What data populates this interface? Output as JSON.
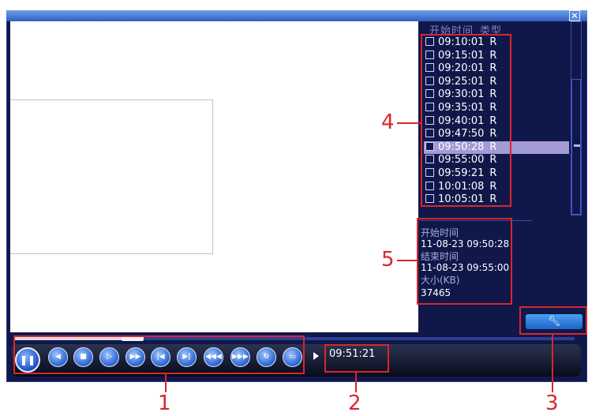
{
  "window": {
    "close_icon": "close-icon",
    "colors": {
      "panel_bg": "#10184a",
      "selected_row": "#a39ad6",
      "callout": "#d9262a",
      "title_bar": "#4f82d8"
    }
  },
  "record_list": {
    "headers": [
      "开始时间",
      "类型"
    ],
    "rows": [
      {
        "time": "09:10:01",
        "type": "R"
      },
      {
        "time": "09:15:01",
        "type": "R"
      },
      {
        "time": "09:20:01",
        "type": "R"
      },
      {
        "time": "09:25:01",
        "type": "R"
      },
      {
        "time": "09:30:01",
        "type": "R"
      },
      {
        "time": "09:35:01",
        "type": "R"
      },
      {
        "time": "09:40:01",
        "type": "R"
      },
      {
        "time": "09:47:50",
        "type": "R"
      },
      {
        "time": "09:50:28",
        "type": "R",
        "selected": true
      },
      {
        "time": "09:55:00",
        "type": "R"
      },
      {
        "time": "09:59:21",
        "type": "R"
      },
      {
        "time": "10:01:08",
        "type": "R"
      },
      {
        "time": "10:05:01",
        "type": "R"
      }
    ]
  },
  "info": {
    "start_label": "开始时间",
    "start_value": "11-08-23 09:50:28",
    "end_label": "结束时间",
    "end_value": "11-08-23 09:55:00",
    "size_label": "大小(KB)",
    "size_value": "37465"
  },
  "tools_button": {
    "icon": "wrench-icon"
  },
  "playback": {
    "time": "09:51:21",
    "progress_fraction": 0.2,
    "buttons": [
      {
        "name": "pause-button",
        "icon": "pause-icon",
        "glyph": "❚❚"
      },
      {
        "name": "reverse-play-button",
        "icon": "reverse-play-icon",
        "glyph": "◀"
      },
      {
        "name": "stop-button",
        "icon": "stop-icon",
        "glyph": "■"
      },
      {
        "name": "slow-play-button",
        "icon": "slow-play-icon",
        "glyph": "▷"
      },
      {
        "name": "fast-forward-button",
        "icon": "fast-forward-icon",
        "glyph": "▶▶"
      },
      {
        "name": "previous-frame-button",
        "icon": "previous-frame-icon",
        "glyph": "|◀"
      },
      {
        "name": "next-frame-button",
        "icon": "next-frame-icon",
        "glyph": "▶|"
      },
      {
        "name": "previous-file-button",
        "icon": "previous-file-icon",
        "glyph": "◀◀◀"
      },
      {
        "name": "next-file-button",
        "icon": "next-file-icon",
        "glyph": "▶▶▶"
      },
      {
        "name": "loop-button",
        "icon": "loop-icon",
        "glyph": "↻"
      },
      {
        "name": "fullscreen-button",
        "icon": "fullscreen-icon",
        "glyph": "▭"
      }
    ]
  },
  "callouts": [
    "1",
    "2",
    "3",
    "4",
    "5"
  ]
}
